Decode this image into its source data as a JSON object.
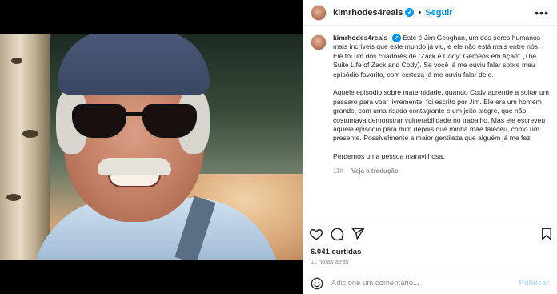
{
  "post": {
    "username": "kimrhodes4reals",
    "separator": "•",
    "follow_label": "Seguir",
    "more_label": "•••",
    "caption": [
      "Este é Jim Geoghan, um dos seres humanos mais incríveis que este mundo já viu, e ele não está mais entre nós. Ele foi um dos criadores de \"Zack e Cody: Gêmeos em Ação\" (The Suite Life of Zack and Cody). Se você já me ouviu falar sobre meu episódio favorito, com certeza já me ouviu falar dele.",
      "Aquele episódio sobre maternidade, quando Cody aprende a soltar um pássaro para voar livremente, foi escrito por Jim. Ele era um homem grande, com uma risada contagiante e um jeito alegre, que não costumava demonstrar vulnerabilidade no trabalho. Mas ele escreveu aquele episódio para mim depois que minha mãe faleceu, como um presente. Possivelmente a maior gentileza que alguém já me fez.",
      "Perdemos uma pessoa maravilhosa."
    ],
    "caption_time": "11h",
    "translate_label": "Veja a tradução",
    "likes": "6.041 curtidas",
    "posted_ago": "11 horas atrás"
  },
  "comment": {
    "placeholder": "Adicione um comentário...",
    "publish_label": "Publicar"
  },
  "icons": {
    "like": "heart-icon",
    "comment": "comment-icon",
    "share": "send-icon",
    "save": "bookmark-icon",
    "emoji": "emoji-icon"
  },
  "colors": {
    "accent": "#0095f6",
    "publish_disabled": "#b2dffc",
    "muted": "#8e8e8e"
  }
}
